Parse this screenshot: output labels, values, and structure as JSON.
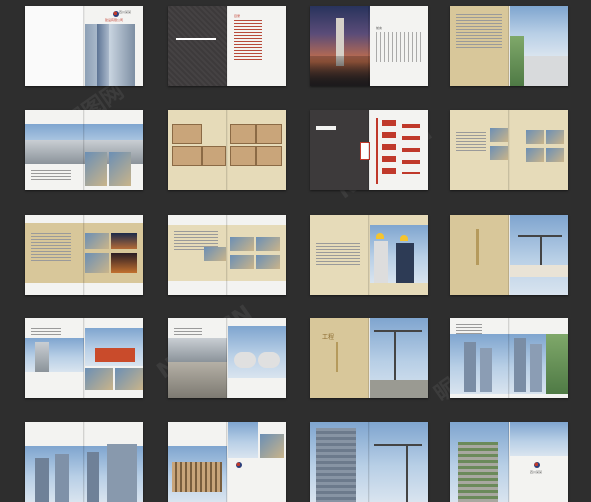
{
  "watermark": {
    "cn": "昵图网",
    "en": "NIPIC.CN"
  },
  "spreads": [
    {
      "id": "01",
      "texts": {
        "company": "四川某某",
        "company_sub": "建设有限公司"
      }
    },
    {
      "id": "02",
      "texts": {
        "heading": "目录"
      }
    },
    {
      "id": "03",
      "texts": {
        "heading": "前言"
      }
    },
    {
      "id": "04",
      "texts": {}
    },
    {
      "id": "05",
      "texts": {}
    },
    {
      "id": "06",
      "texts": {}
    },
    {
      "id": "07",
      "texts": {}
    },
    {
      "id": "08",
      "texts": {}
    },
    {
      "id": "09",
      "texts": {}
    },
    {
      "id": "10",
      "texts": {}
    },
    {
      "id": "11",
      "texts": {}
    },
    {
      "id": "12",
      "texts": {
        "title": "工程"
      }
    },
    {
      "id": "13",
      "texts": {}
    },
    {
      "id": "14",
      "texts": {}
    },
    {
      "id": "15",
      "texts": {
        "title": "工程"
      }
    },
    {
      "id": "16",
      "texts": {}
    },
    {
      "id": "17",
      "texts": {}
    },
    {
      "id": "18",
      "texts": {}
    },
    {
      "id": "19",
      "texts": {}
    },
    {
      "id": "20",
      "texts": {
        "company": "四川某某"
      }
    }
  ],
  "colors": {
    "background": "#2e2e2e",
    "tan": "#d8c79a",
    "dark_page": "#3d3a3b",
    "accent_red": "#c0392b"
  }
}
